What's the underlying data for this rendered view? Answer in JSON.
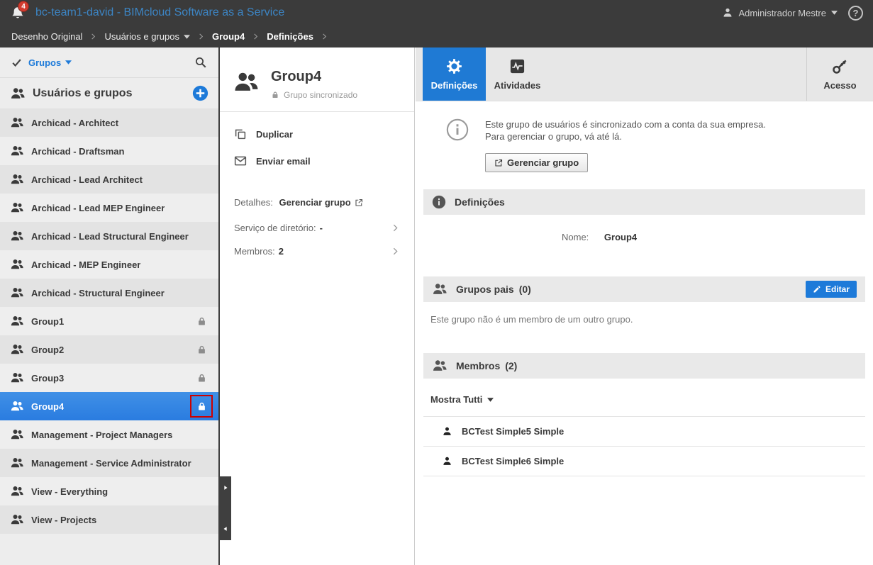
{
  "colors": {
    "accent_blue": "#1d7ad9",
    "title_blue": "#3c85c4",
    "badge_red": "#d23b2e",
    "annotation_red": "#cc0000",
    "topbar_bg": "#3b3b3b",
    "selected_row_blue": "#2a7ce0",
    "tab_active_blue": "#1f7ad4"
  },
  "topbar": {
    "title": "bc-team1-david - BIMcloud Software as a Service",
    "notifications_count": "4",
    "user_label": "Administrador Mestre",
    "help_label": "?"
  },
  "breadcrumb": {
    "items": [
      {
        "label": "Desenho Original",
        "dropdown": false,
        "bold": false
      },
      {
        "label": "Usuários e grupos",
        "dropdown": true,
        "bold": false
      },
      {
        "label": "Group4",
        "dropdown": false,
        "bold": true
      },
      {
        "label": "Definições",
        "dropdown": false,
        "bold": true
      }
    ]
  },
  "sidebar": {
    "filter_label": "Grupos",
    "header": "Usuários e grupos",
    "items": [
      {
        "label": "Archicad - Architect",
        "locked": false,
        "selected": false
      },
      {
        "label": "Archicad - Draftsman",
        "locked": false,
        "selected": false
      },
      {
        "label": "Archicad - Lead Architect",
        "locked": false,
        "selected": false
      },
      {
        "label": "Archicad - Lead MEP Engineer",
        "locked": false,
        "selected": false
      },
      {
        "label": "Archicad - Lead Structural Engineer",
        "locked": false,
        "selected": false
      },
      {
        "label": "Archicad - MEP Engineer",
        "locked": false,
        "selected": false
      },
      {
        "label": "Archicad - Structural Engineer",
        "locked": false,
        "selected": false
      },
      {
        "label": "Group1",
        "locked": true,
        "selected": false
      },
      {
        "label": "Group2",
        "locked": true,
        "selected": false
      },
      {
        "label": "Group3",
        "locked": true,
        "selected": false
      },
      {
        "label": "Group4",
        "locked": true,
        "selected": true,
        "annotated": true
      },
      {
        "label": "Management - Project Managers",
        "locked": false,
        "selected": false
      },
      {
        "label": "Management - Service Administrator",
        "locked": false,
        "selected": false
      },
      {
        "label": "View - Everything",
        "locked": false,
        "selected": false
      },
      {
        "label": "View - Projects",
        "locked": false,
        "selected": false
      }
    ]
  },
  "detail": {
    "title": "Group4",
    "subtitle": "Grupo sincronizado",
    "actions": [
      {
        "label": "Duplicar",
        "icon": "copy"
      },
      {
        "label": "Enviar email",
        "icon": "mail"
      }
    ],
    "details_label": "Detalhes:",
    "details_link": "Gerenciar grupo",
    "properties": [
      {
        "label": "Serviço de diretório:",
        "value": "-"
      },
      {
        "label": "Membros:",
        "value": "2"
      }
    ]
  },
  "tabs": {
    "items": [
      {
        "label": "Definições",
        "icon": "gear",
        "active": true
      },
      {
        "label": "Atividades",
        "icon": "activity",
        "active": false
      }
    ],
    "access_label": "Acesso"
  },
  "main": {
    "notice": {
      "line1": "Este grupo de usuários é sincronizado com a conta da sua empresa.",
      "line2": "Para gerenciar o grupo, vá até lá.",
      "button": "Gerenciar grupo"
    },
    "definitions": {
      "title": "Definições",
      "name_label": "Nome:",
      "name_value": "Group4"
    },
    "parent_groups": {
      "title": "Grupos pais",
      "count": "(0)",
      "edit_button": "Editar",
      "empty_text": "Este grupo não é um membro de um outro grupo."
    },
    "members": {
      "title": "Membros",
      "count": "(2)",
      "filter_label": "Mostra Tutti",
      "items": [
        {
          "name": "BCTest Simple5 Simple"
        },
        {
          "name": "BCTest Simple6 Simple"
        }
      ]
    }
  }
}
